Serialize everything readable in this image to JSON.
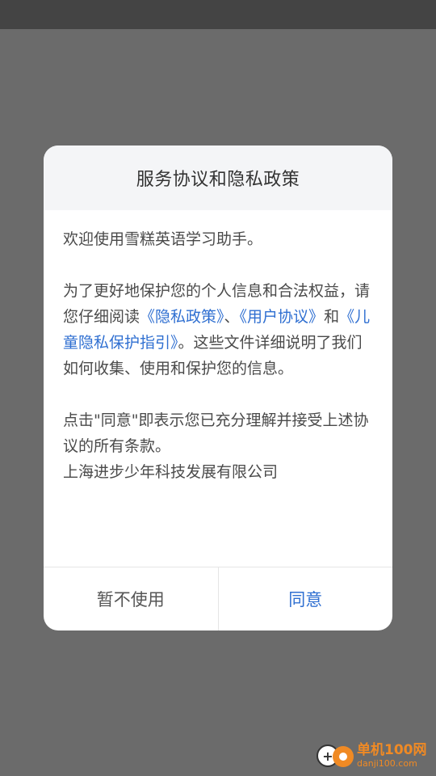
{
  "dialog": {
    "title": "服务协议和隐私政策",
    "welcome": "欢迎使用雪糕英语学习助手。",
    "para2": {
      "prefix": "为了更好地保护您的个人信息和合法权益，请您仔细阅读",
      "link_privacy": "《隐私政策》",
      "sep1": "、",
      "link_user": "《用户协议》",
      "sep2": "和",
      "link_child": "《儿童隐私保护指引》",
      "suffix": "。这些文件详细说明了我们如何收集、使用和保护您的信息。"
    },
    "para3": "点击\"同意\"即表示您已充分理解并接受上述协议的所有条款。",
    "company": "上海进步少年科技发展有限公司",
    "decline_label": "暂不使用",
    "agree_label": "同意"
  },
  "watermark": {
    "name": "单机100网",
    "domain": "danji100.com"
  },
  "colors": {
    "overlay": "#6b6b6b",
    "status_bar": "#444444",
    "link": "#2f6fd1",
    "watermark": "#f08a24"
  }
}
